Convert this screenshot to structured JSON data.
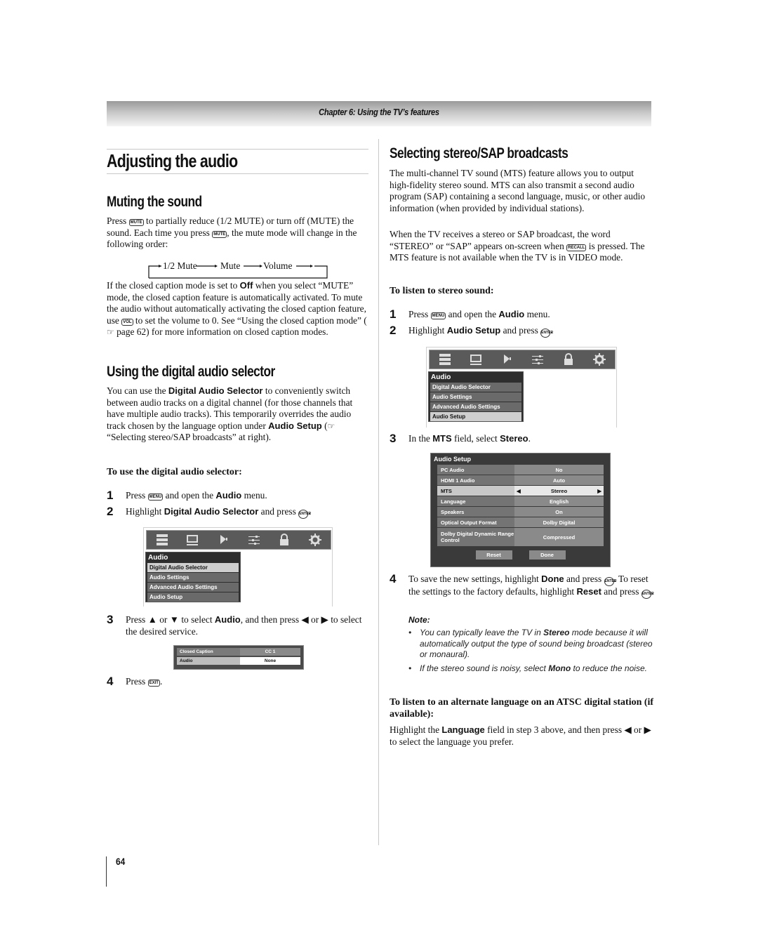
{
  "header": {
    "chapter_title": "Chapter 6: Using the TV’s features"
  },
  "left": {
    "title": "Adjusting the audio",
    "muting": {
      "heading": "Muting the sound",
      "p1_a": "Press ",
      "mute_key": "MUTE",
      "p1_b": " to partially reduce (1/2 MUTE) or turn off (MUTE) the sound. Each time you press ",
      "p1_c": ", the mute mode will change in the following order:",
      "cycle": [
        "1/2 Mute",
        "Mute",
        "Volume"
      ],
      "p2_a": "If the closed caption mode is set to ",
      "p2_off": "Off",
      "p2_b": " when you select “MUTE” mode, the closed caption feature is automatically activated. To mute the audio without automatically activating the closed caption feature, use ",
      "vol_key": "VOL",
      "p2_c": " to set the volume to 0. See “Using the closed caption mode” (",
      "p2_ref": "☞",
      "p2_d": " page 62) for more information on closed caption modes."
    },
    "digital": {
      "heading": "Using the digital audio selector",
      "p_a": "You can use the ",
      "p_bold1": "Digital Audio Selector",
      "p_b": " to conveniently switch between audio tracks on a digital channel (for those channels that have multiple audio tracks). This temporarily overrides the audio track chosen by the language option under ",
      "p_bold2": "Audio Setup",
      "p_c": " (",
      "p_ref": "☞",
      "p_d": " “Selecting stereo/SAP broadcasts” at right).",
      "subheading": "To use the digital audio selector:",
      "steps": [
        {
          "num": "1",
          "a": "Press ",
          "key": "MENU",
          "b": " and open the ",
          "bold": "Audio",
          "c": " menu."
        },
        {
          "num": "2",
          "a": "Highlight ",
          "bold": "Digital Audio Selector",
          "b": " and press ",
          "key": "ENTER",
          "c": "."
        },
        {
          "num": "3",
          "a": "Press ▲ or ▼ to select ",
          "bold": "Audio",
          "b": ", and then press ◀ or ▶ to select the desired service."
        },
        {
          "num": "4",
          "a": "Press ",
          "key": "EXIT",
          "b": "."
        }
      ],
      "menu": {
        "header": "Audio",
        "items": [
          "Digital Audio Selector",
          "Audio Settings",
          "Advanced Audio Settings",
          "Audio Setup"
        ],
        "selected": "Digital Audio Selector"
      },
      "cc_box": {
        "rows": [
          {
            "label": "Closed Caption",
            "value": "CC 1"
          },
          {
            "label": "Audio",
            "value": "None"
          }
        ]
      }
    },
    "page_number": "64"
  },
  "right": {
    "heading": "Selecting stereo/SAP broadcasts",
    "p1": "The multi-channel TV sound (MTS) feature allows you to output high-fidelity stereo sound. MTS can also transmit a second audio program (SAP) containing a second language, music, or other audio information (when provided by individual stations).",
    "p2_a": "When the TV receives a stereo or SAP broadcast, the word “STEREO” or “SAP” appears on-screen when ",
    "recall_key": "RECALL",
    "p2_b": " is pressed. The MTS feature is not available when the TV is in VIDEO mode.",
    "subheading": "To listen to stereo sound:",
    "steps": [
      {
        "num": "1",
        "a": "Press ",
        "key": "MENU",
        "b": " and open the ",
        "bold": "Audio",
        "c": " menu."
      },
      {
        "num": "2",
        "a": "Highlight ",
        "bold": "Audio Setup",
        "b": " and press ",
        "key": "ENTER",
        "c": "."
      },
      {
        "num": "3",
        "a": "In the ",
        "bold": "MTS",
        "b": " field, select ",
        "bold2": "Stereo",
        "c": "."
      },
      {
        "num": "4",
        "a": "To save the new settings, highlight ",
        "bold": "Done",
        "b": " and press ",
        "key": "ENTER",
        "c": ". To reset the settings to the factory defaults, highlight ",
        "bold2": "Reset",
        "d": " and press ",
        "e": "."
      }
    ],
    "menu": {
      "header": "Audio",
      "items": [
        "Digital Audio Selector",
        "Audio Settings",
        "Advanced Audio Settings",
        "Audio Setup"
      ],
      "selected": "Audio Setup"
    },
    "setup": {
      "header": "Audio Setup",
      "rows": [
        {
          "label": "PC Audio",
          "value": "No"
        },
        {
          "label": "HDMI 1 Audio",
          "value": "Auto"
        },
        {
          "label": "MTS",
          "value": "Stereo"
        },
        {
          "label": "Language",
          "value": "English"
        },
        {
          "label": "Speakers",
          "value": "On"
        },
        {
          "label": "Optical Output Format",
          "value": "Dolby Digital"
        },
        {
          "label": "Dolby Digital Dynamic Range Control",
          "value": "Compressed"
        }
      ],
      "buttons": [
        "Reset",
        "Done"
      ]
    },
    "note": {
      "title": "Note:",
      "items": [
        {
          "a": "You can typically leave the TV in ",
          "bold": "Stereo",
          "b": " mode because it will automatically output the type of sound being broadcast (stereo or monaural)."
        },
        {
          "a": "If the stereo sound is noisy, select ",
          "bold": "Mono",
          "b": " to reduce the noise."
        }
      ]
    },
    "alt": {
      "subheading": "To listen to an alternate language on an ATSC digital station (if available):",
      "p_a": "Highlight the ",
      "p_bold": "Language",
      "p_b": " field in step 3 above, and then press ◀ or ▶ to select the language you prefer."
    }
  }
}
